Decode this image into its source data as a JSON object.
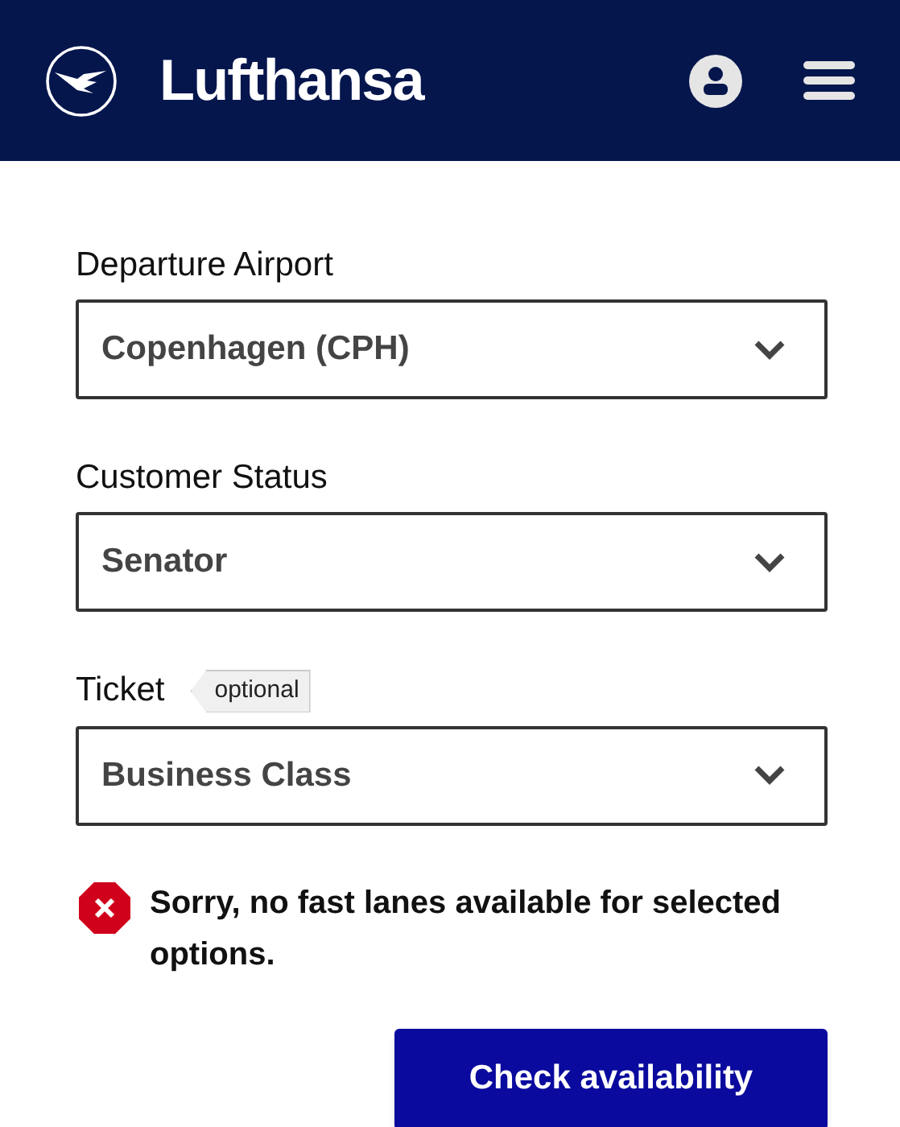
{
  "header": {
    "brand": "Lufthansa"
  },
  "fields": [
    {
      "label": "Departure Airport",
      "value": "Copenhagen (CPH)"
    },
    {
      "label": "Customer Status",
      "value": "Senator"
    },
    {
      "label": "Ticket",
      "badge": "optional",
      "value": "Business Class"
    }
  ],
  "error": {
    "message": "Sorry, no fast lanes available for selected options."
  },
  "button": {
    "label": "Check availability"
  }
}
